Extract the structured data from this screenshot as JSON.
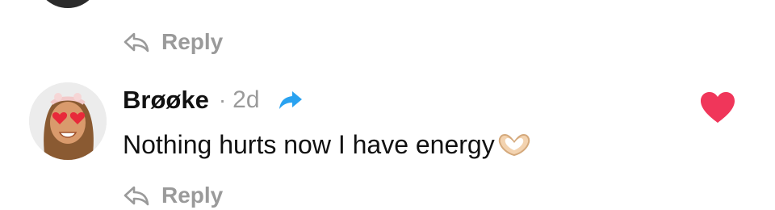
{
  "previous_comment": {
    "reply_label": "Reply"
  },
  "comment": {
    "author": "Brøøke",
    "separator": "·",
    "timestamp": "2d",
    "text": "Nothing hurts now I have energy",
    "emoji": "heart-hands-icon",
    "liked": true,
    "reply_label": "Reply"
  },
  "colors": {
    "muted": "#9a9a9a",
    "share_blue": "#2aa2f0",
    "like_red": "#f0365a"
  }
}
